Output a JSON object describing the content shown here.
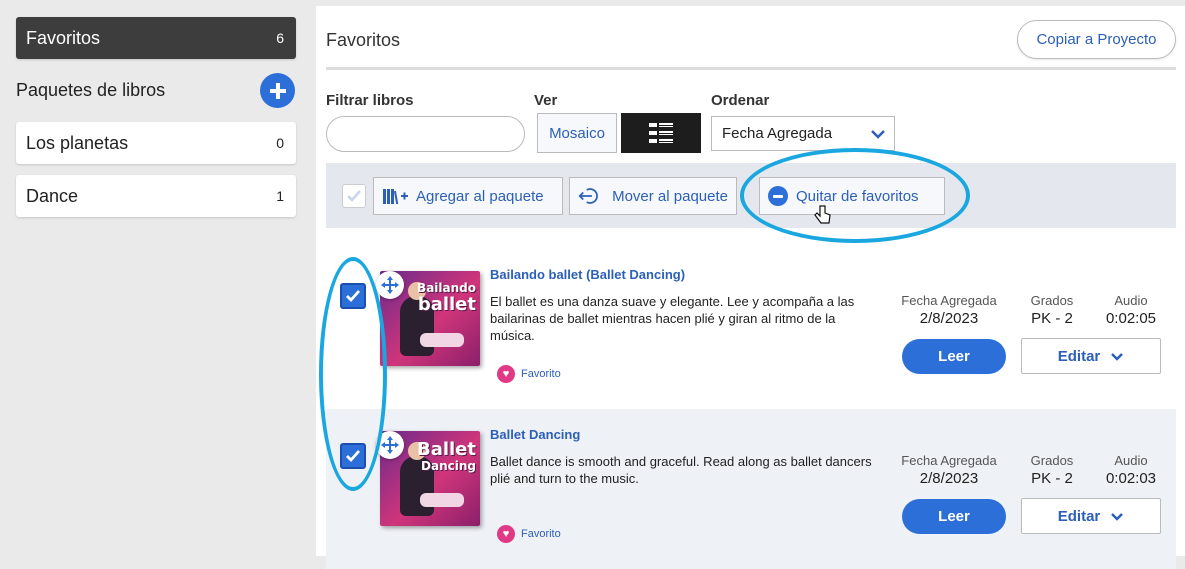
{
  "sidebar": {
    "active": {
      "label": "Favoritos",
      "count": "6"
    },
    "heading": "Paquetes de libros",
    "items": [
      {
        "label": "Los planetas",
        "count": "0"
      },
      {
        "label": "Dance",
        "count": "1"
      }
    ]
  },
  "header": {
    "title": "Favoritos",
    "copy_label": "Copiar a Proyecto"
  },
  "filters": {
    "filter_label": "Filtrar libros",
    "filter_value": "",
    "view_label": "Ver",
    "view_mosaic": "Mosaico",
    "sort_label": "Ordenar",
    "sort_value": "Fecha Agregada"
  },
  "toolbar": {
    "add_label": "Agregar al paquete",
    "move_label": "Mover al paquete",
    "remove_label": "Quitar de favoritos"
  },
  "books": [
    {
      "title": "Bailando ballet (Ballet Dancing)",
      "cover_text_1": "Bailando",
      "cover_text_2": "ballet",
      "description": "El ballet es una danza suave y elegante. Lee y acompaña a las bailarinas de ballet mientras hacen plié y giran al ritmo de la música.",
      "favorite": "Favorito",
      "date_label": "Fecha Agregada",
      "date": "2/8/2023",
      "grades_label": "Grados",
      "grades": "PK - 2",
      "audio_label": "Audio",
      "audio": "0:02:05",
      "read": "Leer",
      "edit": "Editar",
      "checked": true
    },
    {
      "title": "Ballet Dancing",
      "cover_text_1": "Ballet",
      "cover_text_2": "Dancing",
      "description": "Ballet dance is smooth and graceful. Read along as ballet dancers plié and turn to the music.",
      "favorite": "Favorito",
      "date_label": "Fecha Agregada",
      "date": "2/8/2023",
      "grades_label": "Grados",
      "grades": "PK - 2",
      "audio_label": "Audio",
      "audio": "0:02:03",
      "read": "Leer",
      "edit": "Editar",
      "checked": true
    }
  ],
  "colors": {
    "accent": "#2c6fd9",
    "highlight": "#1aa7e0",
    "favorite": "#e03a86",
    "active_bg": "#3d3d3d"
  },
  "icons": [
    "plus-icon",
    "list-view-icon",
    "chevron-down-icon",
    "check-icon",
    "add-to-package-icon",
    "move-package-icon",
    "minus-circle-icon",
    "move-icon",
    "heart-icon",
    "pointer-cursor-icon"
  ]
}
